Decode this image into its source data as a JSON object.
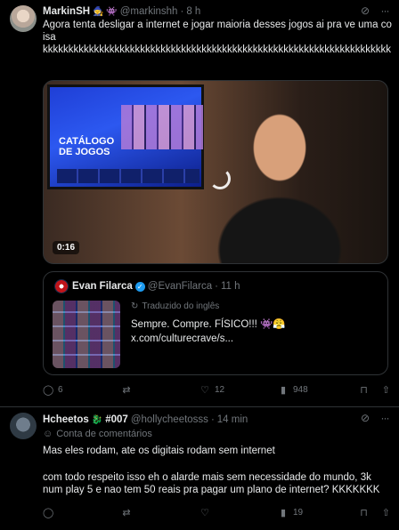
{
  "tweet1": {
    "author_name": "MarkinSH",
    "author_emojis": "🧙 👾",
    "handle": "@markinshh",
    "dot": "·",
    "time": "8 h",
    "text_line1": "Agora tenta desligar a internet e jogar maioria desses jogos ai pra ve uma coisa",
    "text_line2": "kkkkkkkkkkkkkkkkkkkkkkkkkkkkkkkkkkkkkkkkkkkkkkkkkkkkkkkkkkkkkkkkkkkk",
    "media": {
      "tv_title": "CATÁLOGO DE JOGOS",
      "duration": "0:16"
    },
    "quote": {
      "author_name": "Evan Filarca",
      "verified_glyph": "✓",
      "handle": "@EvanFilarca",
      "dot": "·",
      "time": "11 h",
      "translated_label": "Traduzido do inglês",
      "text_line1": "Sempre. Compre. FÍSICO!!! 👾😤",
      "text_line2": "x.com/culturecrave/s..."
    },
    "actions": {
      "replies": "6",
      "retweets": "",
      "likes": "12",
      "views": "948"
    }
  },
  "tweet2": {
    "author_name": "Hcheetos",
    "author_emojis": "🐉",
    "tag": "#007",
    "handle": "@hollycheetosss",
    "dot": "·",
    "time": "14 min",
    "community_label": "Conta de comentários",
    "text_line1": "Mas eles rodam, ate os digitais rodam sem internet",
    "text_line2": "com todo respeito isso eh o alarde mais sem necessidade do mundo, 3k",
    "text_line3": "num play 5 e nao tem 50 reais pra pagar um plano de internet? KKKKKKK",
    "actions": {
      "replies": "",
      "retweets": "",
      "likes": "",
      "views": "19"
    }
  },
  "icons": {
    "reply": "◯",
    "retweet": "⇄",
    "like": "♡",
    "views": "▮",
    "bookmark": "⊓",
    "share": "⇧",
    "grok": "⊘",
    "more": "···",
    "translate": "↻",
    "community": "☺"
  },
  "colors": {
    "background": "#000000",
    "text": "#e7e9ea",
    "secondary": "#71767b",
    "border": "#2f3336",
    "verified": "#1d9bf0"
  }
}
